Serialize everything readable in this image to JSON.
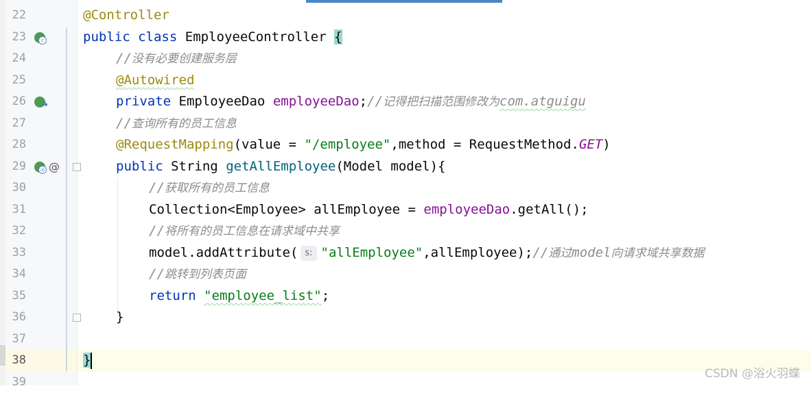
{
  "editor": {
    "lines": [
      {
        "number": "22"
      },
      {
        "number": "23"
      },
      {
        "number": "24"
      },
      {
        "number": "25"
      },
      {
        "number": "26"
      },
      {
        "number": "27"
      },
      {
        "number": "28"
      },
      {
        "number": "29"
      },
      {
        "number": "30"
      },
      {
        "number": "31"
      },
      {
        "number": "32"
      },
      {
        "number": "33"
      },
      {
        "number": "34"
      },
      {
        "number": "35"
      },
      {
        "number": "36"
      },
      {
        "number": "37"
      },
      {
        "number": "38"
      },
      {
        "number": "39"
      }
    ],
    "code": {
      "l22": {
        "annotation": "@Controller"
      },
      "l23": {
        "kw1": "public",
        "kw2": "class",
        "name": "EmployeeController",
        "brace": "{"
      },
      "l24": {
        "slashes": "//",
        "comment": "没有必要创建服务层"
      },
      "l25": {
        "annotation": "@Autowired"
      },
      "l26": {
        "kw": "private",
        "type": "EmployeeDao",
        "field": "employeeDao",
        "semi": ";",
        "slashes": "//",
        "comment": "记得把扫描范围修改为",
        "comment_pkg": "com.atguigu"
      },
      "l27": {
        "slashes": "//",
        "comment": "查询所有的员工信息"
      },
      "l28": {
        "annotation": "@RequestMapping",
        "p1": "(value = ",
        "str": "\"/employee\"",
        "p2": ",method = RequestMethod.",
        "const": "GET",
        "p3": ")"
      },
      "l29": {
        "kw1": "public",
        "type": "String",
        "method": "getAllEmployee",
        "params": "(Model model){"
      },
      "l30": {
        "slashes": "//",
        "comment": "获取所有的员工信息"
      },
      "l31": {
        "p1": "Collection<Employee> allEmployee = ",
        "field": "employeeDao",
        "p2": ".getAll();"
      },
      "l32": {
        "slashes": "//",
        "comment": "将所有的员工信息在请求域中共享"
      },
      "l33": {
        "p1": "model.addAttribute(",
        "hint": "s:",
        "str": "\"allEmployee\"",
        "p2": ",allEmployee);",
        "slashes": "//",
        "comment1": "通过",
        "comment_model": "model",
        "comment2": "向请求域共享数据"
      },
      "l34": {
        "slashes": "//",
        "comment": "跳转到列表页面"
      },
      "l35": {
        "kw": "return",
        "str": "\"employee_list\"",
        "semi": ";"
      },
      "l36": {
        "brace": "}"
      },
      "l38": {
        "brace": "}"
      }
    },
    "gutter_icons": [
      "spring-bean-icon",
      "spring-autowired-icon",
      "spring-request-mapping-icon",
      "at-icon"
    ]
  },
  "watermark": "CSDN @浴火羽蝶",
  "colors": {
    "keyword": "#0033b3",
    "annotation": "#9e880d",
    "field": "#871094",
    "string": "#067d17",
    "method": "#00627a",
    "comment": "#8c8c8c"
  }
}
